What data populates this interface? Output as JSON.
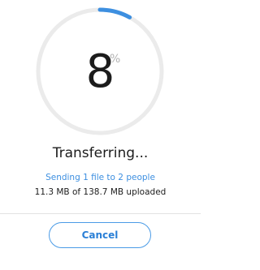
{
  "transfer": {
    "progress_percent": 8,
    "percent_value": "8",
    "percent_sign": "%",
    "title": "Transferring...",
    "subtitle": "Sending 1 file to 2 people",
    "bytes_status": "11.3 MB of 138.7 MB uploaded"
  },
  "actions": {
    "cancel_label": "Cancel"
  },
  "colors": {
    "ring_track": "#ebebeb",
    "ring_progress": "#3d8fe0",
    "accent": "#3d8fe0"
  }
}
